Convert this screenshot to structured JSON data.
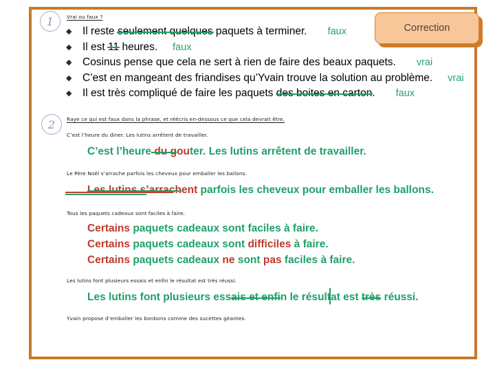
{
  "document": {
    "frame_color": "#c8782b",
    "background": "#ffffff"
  },
  "correction_button": {
    "label": "Correction",
    "fill": "#f7c79a",
    "border": "#d98030",
    "shadow": "#cf7b2b"
  },
  "exercise_1": {
    "number": "1",
    "instruction": "Vrai ou faux ?",
    "bullet_glyph": "♦",
    "items": [
      {
        "pre": "Il reste ",
        "struck": "seulement quelques",
        "post": " paquets à terminer.",
        "answer": "faux"
      },
      {
        "pre": "Il est ",
        "struck": "11",
        "post": " heures.",
        "answer": "faux"
      },
      {
        "pre": "Cosinus pense que cela ne sert à rien de faire des beaux paquets.",
        "struck": "",
        "post": "",
        "answer": "vrai"
      },
      {
        "pre": "C’est en mangeant des friandises qu’Yvain trouve la solution au problème.",
        "struck": "",
        "post": "",
        "answer": "vrai"
      },
      {
        "pre": "Il est très compliqué de faire les paquets ",
        "struck": "des boites en carton",
        "post": ".",
        "answer": "faux"
      }
    ]
  },
  "exercise_2": {
    "number": "2",
    "instruction": "Raye ce qui est faux dans la phrase, et réécris en-dessous ce que cela devrait être.",
    "sentences": [
      {
        "source": "C’est l’heure du diner. Les lutins arrêtent de travailler.",
        "answer_parts": [
          {
            "text": "C’est l’heure",
            "style": "green"
          },
          {
            "text": " du g",
            "style": "strike-red"
          },
          {
            "text": "ou",
            "style": "red"
          },
          {
            "text": "ter. Les lutins arrêtent de travailler.",
            "style": "green"
          }
        ]
      },
      {
        "source": "Le Père Noël s’arrache parfois les cheveux pour emballer les ballons.",
        "answer_parts": [
          {
            "text": "Les lutins s’arrach",
            "style": "strike-red"
          },
          {
            "text": "ent",
            "style": "red"
          },
          {
            "text": " parfois les cheveux pour emballer les ballons.",
            "style": "green"
          }
        ]
      },
      {
        "source": "Tous les paquets cadeaux sont faciles à faire.",
        "answer_lines": [
          [
            {
              "text": "Certains",
              "style": "red"
            },
            {
              "text": " paquets cadeaux sont faciles à faire.",
              "style": "green"
            }
          ],
          [
            {
              "text": "Certains",
              "style": "red"
            },
            {
              "text": " paquets cadeaux sont ",
              "style": "green"
            },
            {
              "text": "difficiles",
              "style": "red"
            },
            {
              "text": " à faire.",
              "style": "green"
            }
          ],
          [
            {
              "text": "Certains",
              "style": "red"
            },
            {
              "text": " paquets cadeaux ",
              "style": "green"
            },
            {
              "text": "ne",
              "style": "red"
            },
            {
              "text": " sont ",
              "style": "green"
            },
            {
              "text": "pas",
              "style": "red"
            },
            {
              "text": " faciles à faire.",
              "style": "green"
            }
          ]
        ]
      },
      {
        "source": "Les lutins font plusieurs essais et enfin le résultat  est très réussi.",
        "answer_parts": [
          {
            "text": "Les lutins font plusieurs ess",
            "style": "green"
          },
          {
            "text": "ais et enfi",
            "style": "strike-self"
          },
          {
            "text": "n le résulta",
            "style": "green"
          },
          {
            "text": "t est ",
            "style": "green"
          },
          {
            "text": "très",
            "style": "strike-self"
          },
          {
            "text": " réussi.",
            "style": "green"
          }
        ]
      },
      {
        "source": "Yvain propose d’emballer les bonbons comme des sucettes géantes.",
        "answer_parts": []
      }
    ]
  },
  "colors": {
    "green": "#20a06a",
    "red": "#c0392b",
    "lavender": "#9b90b5",
    "orange": "#c8782b"
  }
}
